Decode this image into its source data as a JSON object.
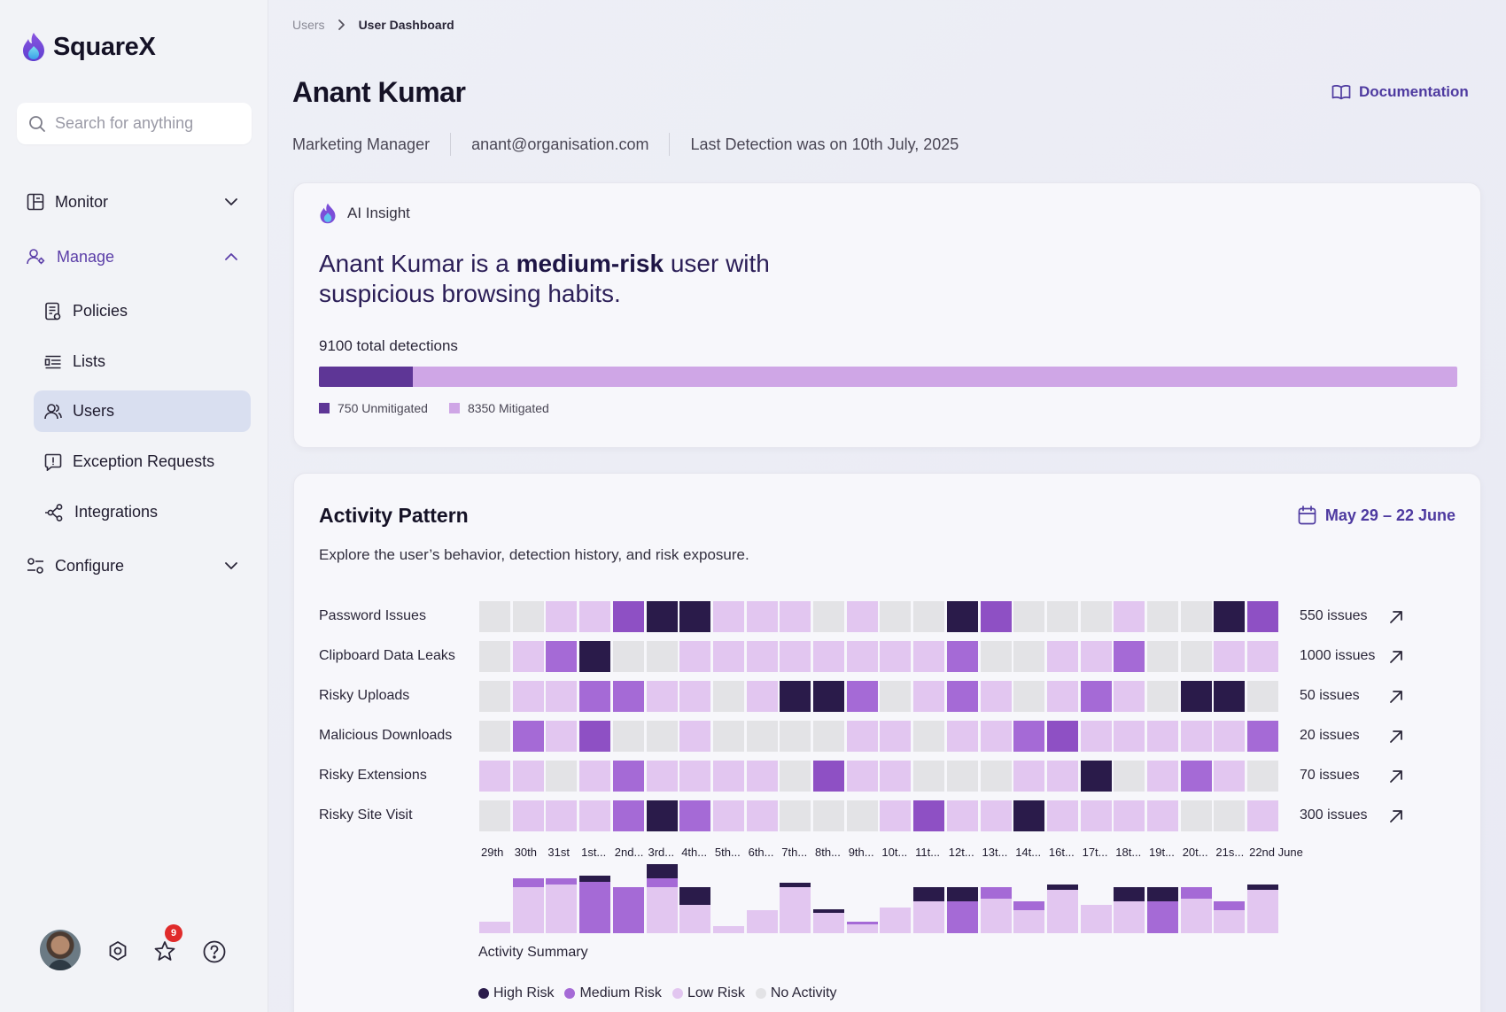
{
  "app": {
    "name": "SquareX"
  },
  "search": {
    "placeholder": "Search for anything"
  },
  "sidebar": {
    "monitor": "Monitor",
    "manage": "Manage",
    "configure": "Configure",
    "items": [
      {
        "label": "Policies",
        "icon": "policies-icon"
      },
      {
        "label": "Lists",
        "icon": "lists-icon"
      },
      {
        "label": "Users",
        "icon": "users-icon",
        "selected": true
      },
      {
        "label": "Exception Requests",
        "icon": "exception-icon"
      },
      {
        "label": "Integrations",
        "icon": "integrations-icon"
      }
    ],
    "notification_count": "9"
  },
  "breadcrumb": {
    "parent": "Users",
    "current": "User Dashboard"
  },
  "user": {
    "name": "Anant Kumar",
    "role": "Marketing Manager",
    "email": "anant@organisation.com",
    "last_detection": "Last Detection was on 10th July, 2025"
  },
  "header": {
    "documentation": "Documentation"
  },
  "ai": {
    "label": "AI Insight",
    "sentence_pre": "Anant Kumar is a ",
    "sentence_bold": "medium-risk",
    "sentence_post": " user with suspicious browsing habits.",
    "total": "9100 total detections",
    "unmitigated_value": 750,
    "mitigated_value": 8350,
    "unmitigated_label": "750 Unmitigated",
    "mitigated_label": "8350 Mitigated"
  },
  "activity": {
    "title": "Activity Pattern",
    "date_range": "May 29 – 22 June",
    "description": "Explore the user’s behavior, detection history, and risk exposure.",
    "summary_title": "Activity Summary",
    "legend": [
      {
        "label": "High Risk",
        "color": "#2a1b4a"
      },
      {
        "label": "Medium Risk",
        "color": "#a56ad6"
      },
      {
        "label": "Low Risk",
        "color": "#e2c6f0"
      },
      {
        "label": "No Activity",
        "color": "#e3e3e6"
      }
    ],
    "level_colors": {
      "0": "#e3e3e6",
      "1": "#e2c6f0",
      "2": "#a56ad6",
      "3": "#2a1b4a",
      "4": "#8e50c4"
    },
    "days": [
      "29th",
      "30th",
      "31st",
      "1st...",
      "2nd...",
      "3rd...",
      "4th...",
      "5th...",
      "6th...",
      "7th...",
      "8th...",
      "9th...",
      "10t...",
      "11t...",
      "12t...",
      "13t...",
      "14t...",
      "16t...",
      "17t...",
      "18t...",
      "19t...",
      "20t...",
      "21s...",
      "22nd June"
    ],
    "rows": [
      {
        "label": "Password Issues",
        "count": "550 issues",
        "levels": [
          0,
          0,
          1,
          1,
          4,
          3,
          3,
          1,
          1,
          1,
          0,
          1,
          0,
          0,
          3,
          4,
          0,
          0,
          0,
          1,
          0,
          0,
          3,
          4
        ]
      },
      {
        "label": "Clipboard Data Leaks",
        "count": "1000 issues",
        "levels": [
          0,
          1,
          2,
          3,
          0,
          0,
          1,
          1,
          1,
          1,
          1,
          1,
          1,
          1,
          2,
          0,
          0,
          1,
          1,
          2,
          0,
          0,
          1,
          1
        ]
      },
      {
        "label": "Risky Uploads",
        "count": "50 issues",
        "levels": [
          0,
          1,
          1,
          2,
          2,
          1,
          1,
          0,
          1,
          3,
          3,
          2,
          0,
          1,
          2,
          1,
          0,
          1,
          2,
          1,
          0,
          3,
          3,
          0
        ]
      },
      {
        "label": "Malicious Downloads",
        "count": "20 issues",
        "levels": [
          0,
          2,
          1,
          4,
          0,
          0,
          1,
          0,
          0,
          0,
          0,
          1,
          1,
          0,
          1,
          1,
          2,
          4,
          1,
          1,
          1,
          1,
          1,
          2
        ]
      },
      {
        "label": "Risky Extensions",
        "count": "70 issues",
        "levels": [
          1,
          1,
          0,
          1,
          2,
          1,
          1,
          1,
          1,
          0,
          4,
          1,
          1,
          0,
          0,
          0,
          1,
          1,
          3,
          0,
          1,
          2,
          1,
          0
        ]
      },
      {
        "label": "Risky Site Visit",
        "count": "300 issues",
        "levels": [
          0,
          1,
          1,
          1,
          2,
          3,
          2,
          1,
          1,
          0,
          0,
          0,
          1,
          4,
          1,
          1,
          3,
          1,
          1,
          1,
          1,
          0,
          0,
          1
        ]
      }
    ],
    "summary": [
      {
        "low": 0.2,
        "medium": 0,
        "high": 0
      },
      {
        "low": 0.8,
        "medium": 0.15,
        "high": 0
      },
      {
        "low": 0.85,
        "medium": 0.1,
        "high": 0
      },
      {
        "low": 0,
        "medium": 0.9,
        "high": 0.1
      },
      {
        "low": 0,
        "medium": 0.8,
        "high": 0
      },
      {
        "low": 0.8,
        "medium": 0.15,
        "high": 0.25
      },
      {
        "low": 0.5,
        "medium": 0,
        "high": 0.3
      },
      {
        "low": 0.12,
        "medium": 0,
        "high": 0
      },
      {
        "low": 0.4,
        "medium": 0,
        "high": 0
      },
      {
        "low": 0.8,
        "medium": 0,
        "high": 0.07
      },
      {
        "low": 0.35,
        "medium": 0,
        "high": 0.07
      },
      {
        "low": 0.15,
        "medium": 0.05,
        "high": 0
      },
      {
        "low": 0.45,
        "medium": 0,
        "high": 0
      },
      {
        "low": 0.55,
        "medium": 0,
        "high": 0.25
      },
      {
        "low": 0,
        "medium": 0.55,
        "high": 0.25
      },
      {
        "low": 0.6,
        "medium": 0.2,
        "high": 0
      },
      {
        "low": 0.4,
        "medium": 0.15,
        "high": 0
      },
      {
        "low": 0.75,
        "medium": 0,
        "high": 0.1
      },
      {
        "low": 0.5,
        "medium": 0,
        "high": 0
      },
      {
        "low": 0.55,
        "medium": 0,
        "high": 0.25
      },
      {
        "low": 0,
        "medium": 0.55,
        "high": 0.25
      },
      {
        "low": 0.6,
        "medium": 0.2,
        "high": 0
      },
      {
        "low": 0.4,
        "medium": 0.15,
        "high": 0
      },
      {
        "low": 0.75,
        "medium": 0,
        "high": 0.1
      }
    ]
  }
}
